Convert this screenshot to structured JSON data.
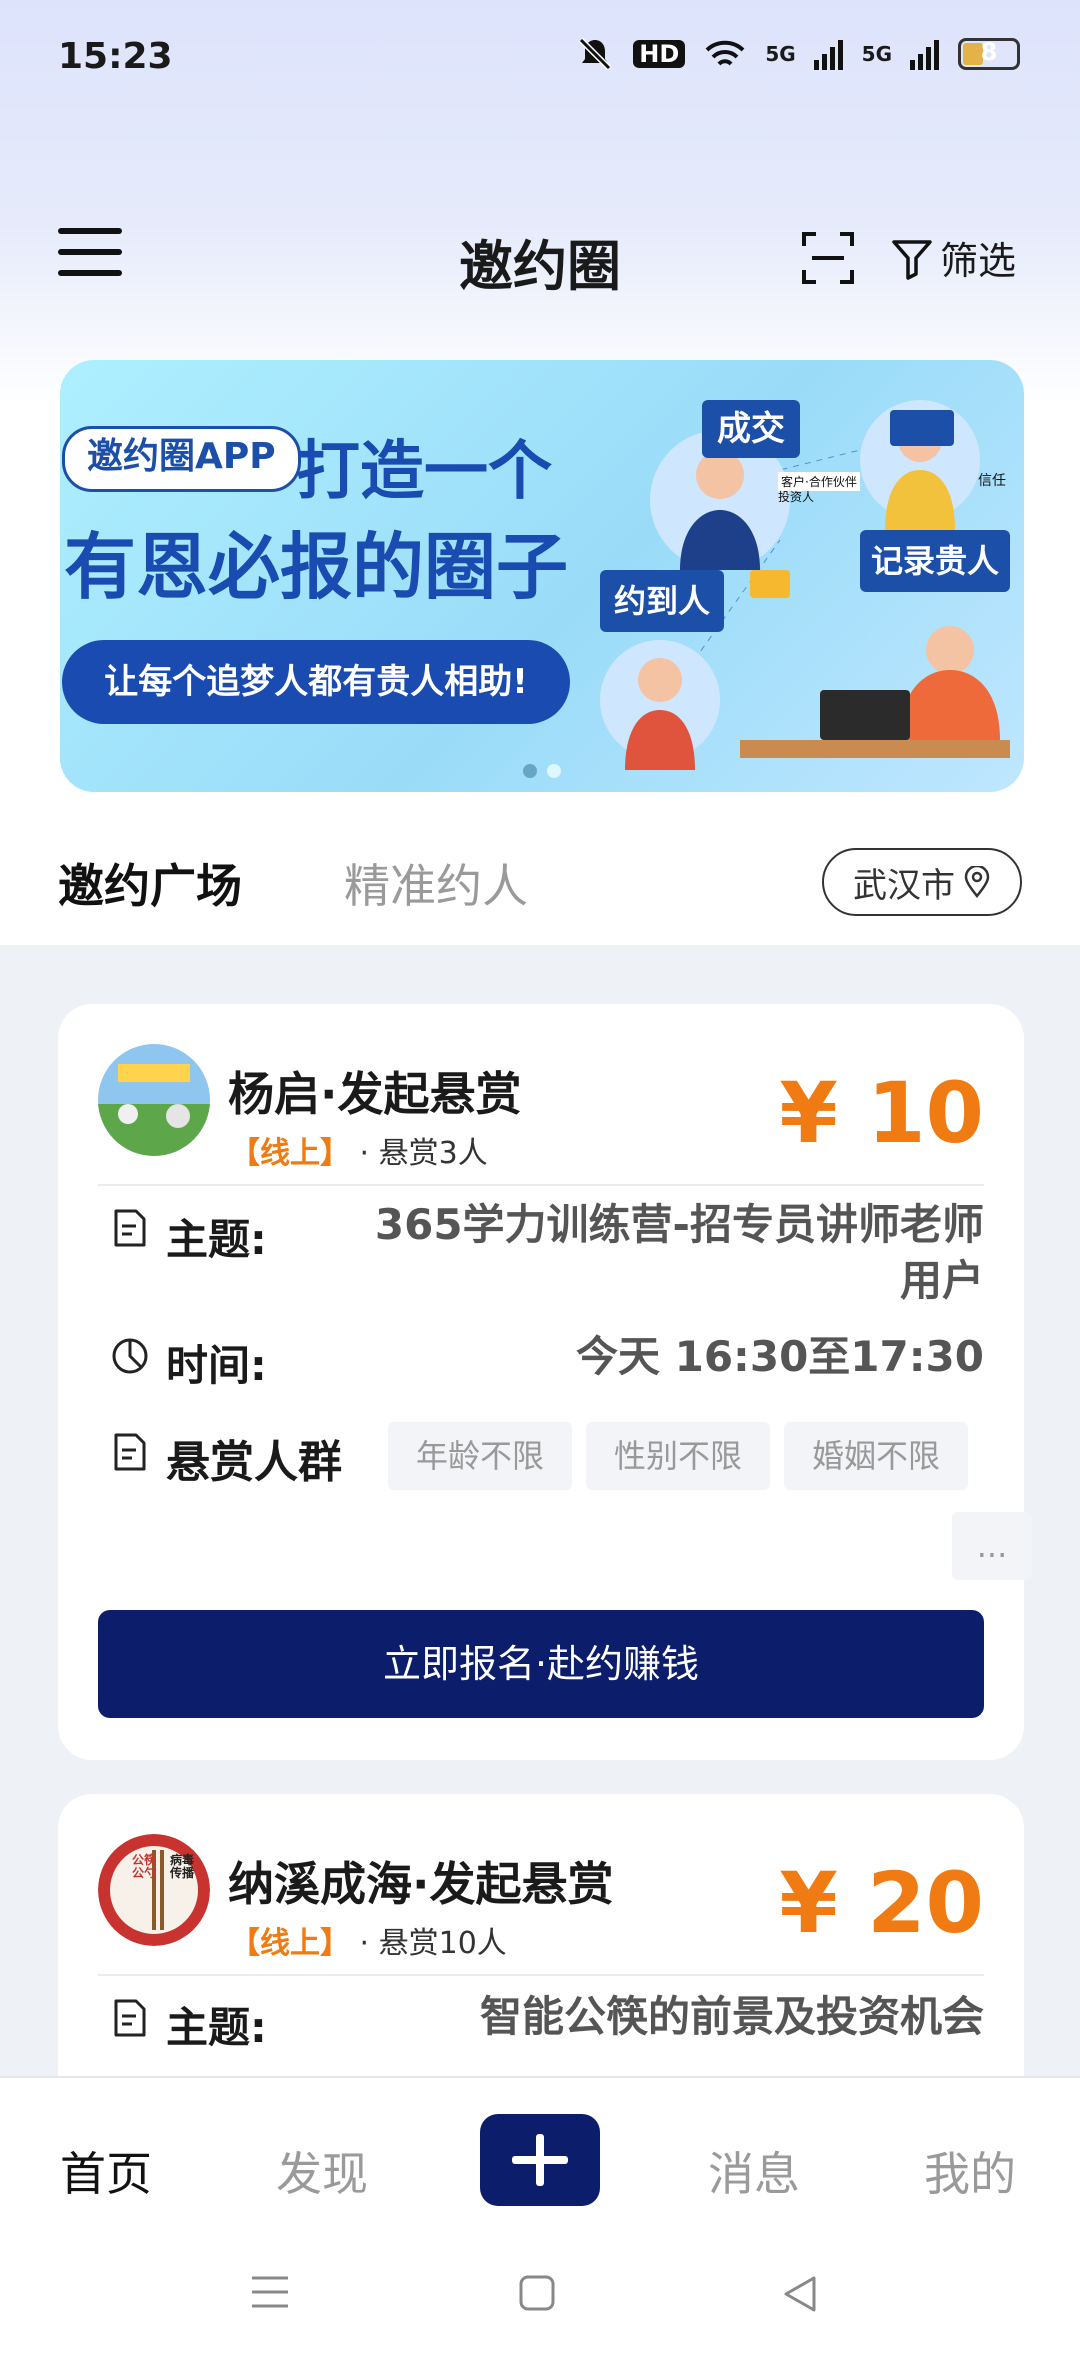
{
  "status_bar": {
    "time": "15:23",
    "signal_labels": [
      "HD",
      "5G",
      "5G"
    ],
    "battery": "8"
  },
  "header": {
    "title": "邀约圈",
    "filter_label": "筛选"
  },
  "banner": {
    "pill": "邀约圈APP",
    "headline1": "打造一个",
    "headline2": "有恩必报的圈子",
    "cta": "让每个追梦人都有贵人相助!",
    "bubbles": [
      "成交",
      "记录贵人",
      "约到人"
    ],
    "small_labels": [
      "客户·合作伙伴",
      "投资人",
      "信任"
    ]
  },
  "tabs": {
    "active": "邀约广场",
    "inactive": "精准约人"
  },
  "location": {
    "city": "武汉市"
  },
  "cards": [
    {
      "poster": "杨启·发起悬赏",
      "tag": "【线上】",
      "reward_count": "· 悬赏3人",
      "amount": "¥ 10",
      "subject_label": "主题:",
      "subject_line1": "365学力训练营-招专员讲师老师",
      "subject_line2": "用户",
      "time_label": "时间:",
      "time_value": "今天 16:30至17:30",
      "crowd_label": "悬赏人群",
      "chips": [
        "年龄不限",
        "性别不限",
        "婚姻不限",
        "..."
      ],
      "button": "立即报名·赴约赚钱"
    },
    {
      "poster": "纳溪成海·发起悬赏",
      "tag": "【线上】",
      "reward_count": "· 悬赏10人",
      "amount": "¥ 20",
      "subject_label": "主题:",
      "subject_value": "智能公筷的前景及投资机会",
      "avatar_text": [
        "公筷公勺",
        "病毒传播"
      ]
    }
  ],
  "bottom_nav": {
    "items": [
      "首页",
      "发现",
      "消息",
      "我的"
    ]
  },
  "colors": {
    "brand": "#0c1e6b",
    "accent": "#f07b12",
    "banner_blue": "#1a4bb0"
  }
}
